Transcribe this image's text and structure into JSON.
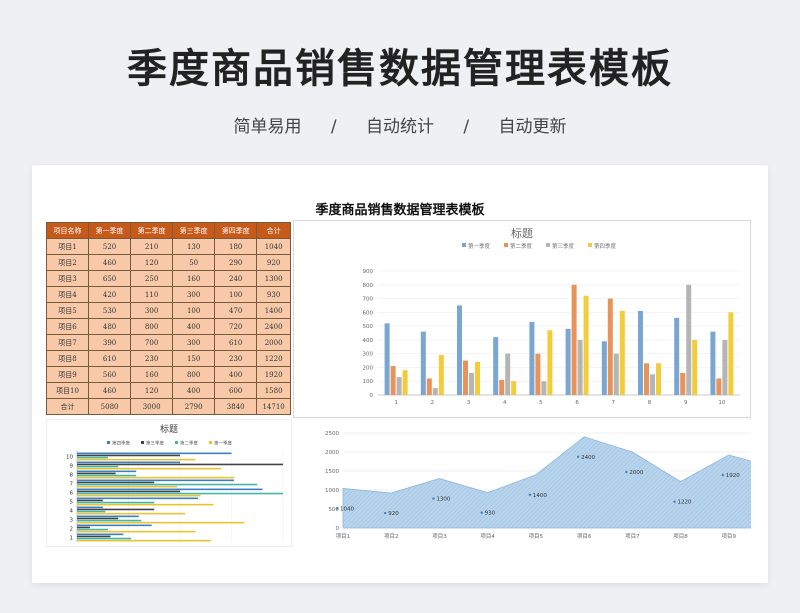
{
  "header": {
    "title": "季度商品销售数据管理表模板",
    "tags": [
      "简单易用",
      "自动统计",
      "自动更新"
    ],
    "sep": "/"
  },
  "sheet": {
    "title": "季度商品销售数据管理表模板",
    "columns": [
      "项目名称",
      "第一季度",
      "第二季度",
      "第三季度",
      "第四季度",
      "合计"
    ],
    "rows": [
      [
        "项目1",
        "520",
        "210",
        "130",
        "180",
        "1040"
      ],
      [
        "项目2",
        "460",
        "120",
        "50",
        "290",
        "920"
      ],
      [
        "项目3",
        "650",
        "250",
        "160",
        "240",
        "1300"
      ],
      [
        "项目4",
        "420",
        "110",
        "300",
        "100",
        "930"
      ],
      [
        "项目5",
        "530",
        "300",
        "100",
        "470",
        "1400"
      ],
      [
        "项目6",
        "480",
        "800",
        "400",
        "720",
        "2400"
      ],
      [
        "项目7",
        "390",
        "700",
        "300",
        "610",
        "2000"
      ],
      [
        "项目8",
        "610",
        "230",
        "150",
        "230",
        "1220"
      ],
      [
        "项目9",
        "560",
        "160",
        "800",
        "400",
        "1920"
      ],
      [
        "项目10",
        "460",
        "120",
        "400",
        "600",
        "1580"
      ],
      [
        "合计",
        "5080",
        "3000",
        "2790",
        "3840",
        "14710"
      ]
    ]
  },
  "colors": {
    "q1": "#7aa6d2",
    "q2": "#e8935a",
    "q3": "#b5b5b5",
    "q4": "#f2cc3a",
    "q4_bar": "#3a7fc1",
    "q3_bar": "#444444",
    "q2_bar": "#45b5a4",
    "q1_bar": "#e9c430",
    "area_fill": "#b8d4ec",
    "area_line": "#8db6dd"
  },
  "chart_data": [
    {
      "type": "bar",
      "title": "标题",
      "categories": [
        "1",
        "2",
        "3",
        "4",
        "5",
        "6",
        "7",
        "8",
        "9",
        "10"
      ],
      "series": [
        {
          "name": "第一季度",
          "values": [
            520,
            460,
            650,
            420,
            530,
            480,
            390,
            610,
            560,
            460
          ]
        },
        {
          "name": "第二季度",
          "values": [
            210,
            120,
            250,
            110,
            300,
            800,
            700,
            230,
            160,
            120
          ]
        },
        {
          "name": "第三季度",
          "values": [
            130,
            50,
            160,
            300,
            100,
            400,
            300,
            150,
            800,
            400
          ]
        },
        {
          "name": "第四季度",
          "values": [
            180,
            290,
            240,
            100,
            470,
            720,
            610,
            230,
            400,
            600
          ]
        }
      ],
      "ylim": [
        0,
        900
      ],
      "yticks": [
        "0",
        "100",
        "200",
        "300",
        "400",
        "500",
        "600",
        "700",
        "800",
        "900"
      ],
      "legend": "top"
    },
    {
      "type": "bar",
      "orientation": "horizontal",
      "title": "标题",
      "categories": [
        "1",
        "2",
        "3",
        "4",
        "5",
        "6",
        "7",
        "8",
        "9",
        "10"
      ],
      "legend_names": [
        "第四季度",
        "第三季度",
        "第二季度",
        "第一季度"
      ],
      "series": [
        {
          "name": "第四季度",
          "values": [
            180,
            290,
            240,
            100,
            470,
            720,
            610,
            230,
            400,
            600
          ]
        },
        {
          "name": "第三季度",
          "values": [
            130,
            50,
            160,
            300,
            100,
            400,
            300,
            150,
            800,
            400
          ]
        },
        {
          "name": "第二季度",
          "values": [
            210,
            120,
            250,
            110,
            300,
            800,
            700,
            230,
            160,
            120
          ]
        },
        {
          "name": "第一季度",
          "values": [
            520,
            460,
            650,
            420,
            530,
            480,
            390,
            610,
            560,
            460
          ]
        }
      ],
      "xlim": [
        0,
        800
      ],
      "legend": "top"
    },
    {
      "type": "area",
      "categories": [
        "项目1",
        "项目2",
        "项目3",
        "项目4",
        "项目5",
        "项目6",
        "项目7",
        "项目8",
        "项目9",
        "项目10"
      ],
      "values": [
        1040,
        920,
        1300,
        930,
        1400,
        2400,
        2000,
        1220,
        1920,
        1580
      ],
      "ylim": [
        0,
        2500
      ],
      "yticks": [
        "0",
        "500",
        "1000",
        "1500",
        "2000",
        "2500"
      ]
    }
  ]
}
